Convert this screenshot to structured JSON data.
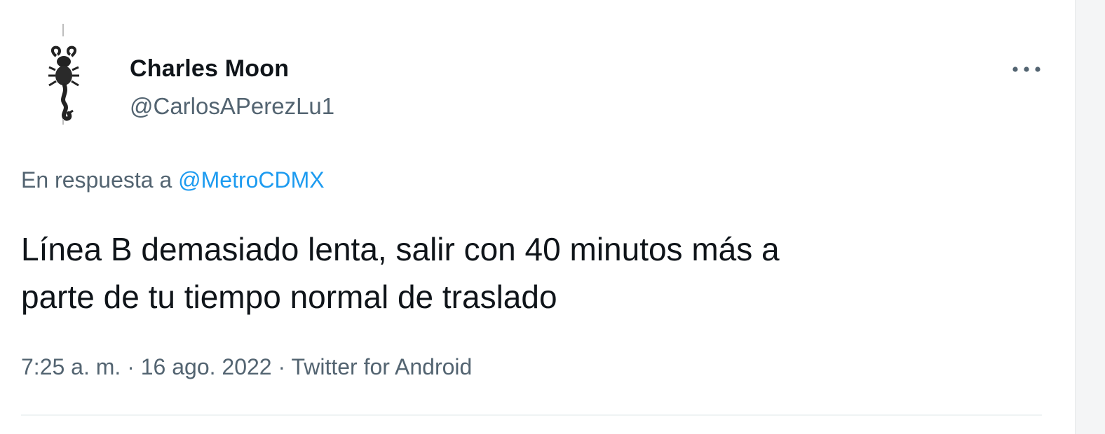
{
  "tweet": {
    "author": {
      "display_name": "Charles Moon",
      "handle": "@CarlosAPerezLu1",
      "avatar_icon": "scorpion-icon"
    },
    "more_icon": "more-options-icon",
    "reply_to": {
      "prefix": "En respuesta a",
      "mention": "@MetroCDMX"
    },
    "text_lines": [
      "Línea B demasiado lenta, salir con 40 minutos más a",
      "parte de tu tiempo normal de traslado"
    ],
    "meta": {
      "time": "7:25 a. m.",
      "separator": "·",
      "date": "16 ago. 2022",
      "source": "Twitter for Android"
    }
  },
  "colors": {
    "text_primary": "#0f1419",
    "text_secondary": "#536471",
    "link": "#1d9bf0",
    "divider": "#eff3f4"
  }
}
